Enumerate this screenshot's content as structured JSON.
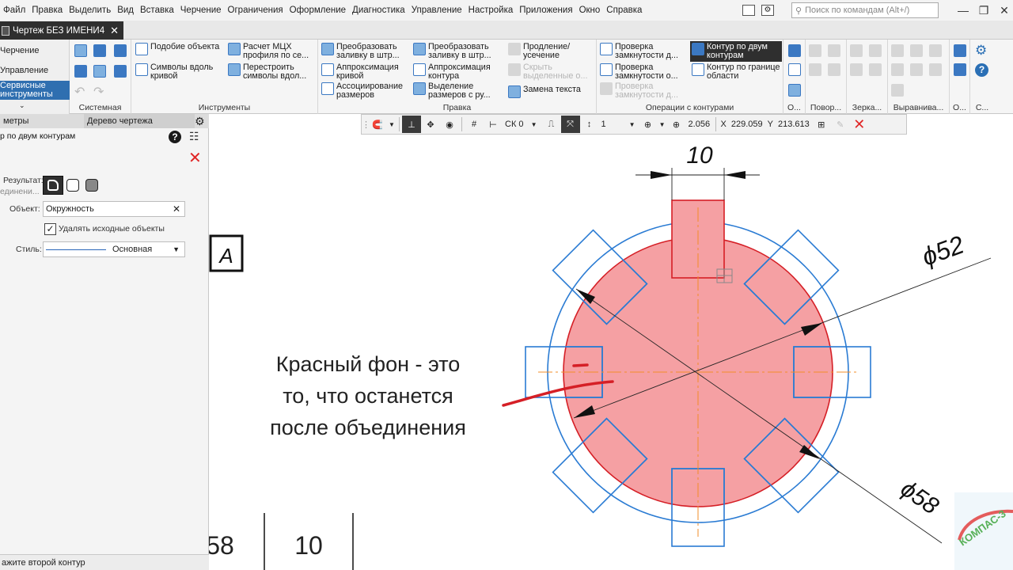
{
  "menu": [
    "Файл",
    "Правка",
    "Выделить",
    "Вид",
    "Вставка",
    "Черчение",
    "Ограничения",
    "Оформление",
    "Диагностика",
    "Управление",
    "Настройка",
    "Приложения",
    "Окно",
    "Справка"
  ],
  "search_placeholder": "Поиск по командам (Alt+/)",
  "doc_tab": "Чертеж БЕЗ ИМЕНИ4",
  "left_tabs": [
    "Черчение",
    "Управление",
    "Сервисные инструменты"
  ],
  "ribbon": {
    "groups": [
      "Системная",
      "Инструменты",
      "Правка",
      "Операции с контурами",
      "О...",
      "Повор...",
      "Зерка...",
      "Выравнива...",
      "О...",
      "С..."
    ],
    "tools": {
      "similar": "Подобие объекта",
      "symbols_curve": "Символы вдоль кривой",
      "mcc": "Расчет МЦХ профиля по се...",
      "rebuild_symbols": "Перестроить символы вдол...",
      "convert_fill1": "Преобразовать заливку в штр...",
      "approx_curve": "Аппроксимация кривой",
      "assoc_dims": "Ассоциирование размеров",
      "convert_fill2": "Преобразовать заливку в штр...",
      "approx_contour": "Аппроксимация контура",
      "select_dims": "Выделение размеров с ру...",
      "extend_trim": "Продление/ усечение",
      "hide_selected": "Скрыть выделенные о...",
      "replace_text": "Замена текста",
      "check_closed1": "Проверка замкнутости д...",
      "check_closed2": "Проверка замкнутости о...",
      "check_closed3": "Проверка замкнутости д...",
      "contour_two": "Контур по двум контурам",
      "contour_boundary": "Контур по границе области"
    }
  },
  "panel": {
    "tab_params": "метры",
    "tab_tree": "Дерево чертежа",
    "command_title": "р по двум контурам",
    "result_label": "Результат:",
    "result_value": "единени...",
    "object_label": "Объект:",
    "object_value": "Окружность",
    "delete_sources": "Удалять исходные объекты",
    "style_label": "Стиль:",
    "style_value": "Основная"
  },
  "status_text": "ажите второй контур",
  "toolbar": {
    "cs": "СК 0",
    "step": "1",
    "zoom": "2.056",
    "x_label": "X",
    "x_value": "229.059",
    "y_label": "Y",
    "y_value": "213.613"
  },
  "drawing": {
    "dim_top": "10",
    "dim_phi52": "ϕ52",
    "dim_phi58": "ϕ58",
    "frame_letter": "А",
    "table_cell1": "58",
    "table_cell2": "10",
    "logo_text": "КОМПАС-3"
  },
  "annotation_lines": [
    "Красный фон - это",
    "то, что останется",
    "после объединения"
  ],
  "colors": {
    "fill": "#f5a0a3",
    "contour_red": "#d51f26",
    "contour_blue": "#2a7bd3",
    "axis_orange": "#f28c28",
    "close_red": "#e02424"
  }
}
